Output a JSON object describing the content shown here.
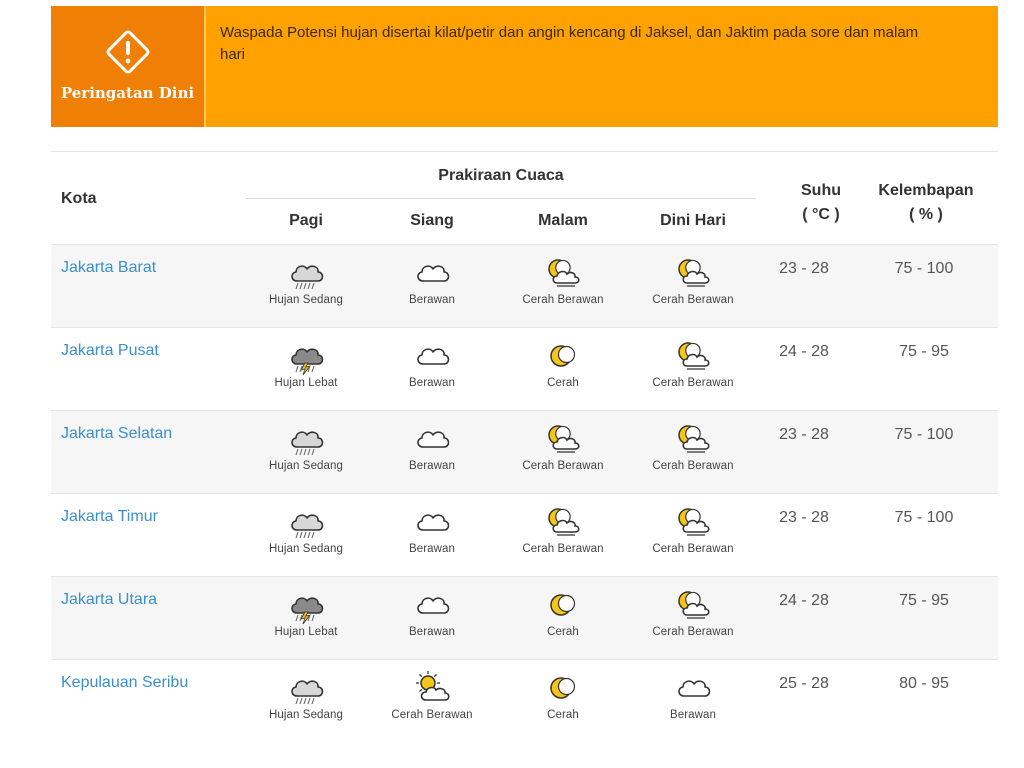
{
  "warning": {
    "badge_label": "Peringatan Dini",
    "text": "Waspada Potensi hujan disertai kilat/petir dan angin kencang di Jaksel, dan Jaktim pada sore dan malam hari",
    "colors": {
      "banner": "#FFA100",
      "badge": "#F07F06"
    }
  },
  "table": {
    "headers": {
      "city": "Kota",
      "forecast": "Prakiraan Cuaca",
      "periods": [
        "Pagi",
        "Siang",
        "Malam",
        "Dini Hari"
      ],
      "temp": "Suhu",
      "temp_unit": "( °C )",
      "humidity": "Kelembapan",
      "humidity_unit": "( % )"
    },
    "rows": [
      {
        "city": "Jakarta Barat",
        "forecast": [
          {
            "icon": "rain-cloud-icon",
            "label": "Hujan Sedang"
          },
          {
            "icon": "cloud-icon",
            "label": "Berawan"
          },
          {
            "icon": "moon-cloud-icon",
            "label": "Cerah Berawan"
          },
          {
            "icon": "moon-cloud-icon",
            "label": "Cerah Berawan"
          }
        ],
        "temp": "23 - 28",
        "humidity": "75 - 100"
      },
      {
        "city": "Jakarta Pusat",
        "forecast": [
          {
            "icon": "storm-cloud-icon",
            "label": "Hujan Lebat"
          },
          {
            "icon": "cloud-icon",
            "label": "Berawan"
          },
          {
            "icon": "moon-icon",
            "label": "Cerah"
          },
          {
            "icon": "moon-cloud-icon",
            "label": "Cerah Berawan"
          }
        ],
        "temp": "24 - 28",
        "humidity": "75 - 95"
      },
      {
        "city": "Jakarta Selatan",
        "forecast": [
          {
            "icon": "rain-cloud-icon",
            "label": "Hujan Sedang"
          },
          {
            "icon": "cloud-icon",
            "label": "Berawan"
          },
          {
            "icon": "moon-cloud-icon",
            "label": "Cerah Berawan"
          },
          {
            "icon": "moon-cloud-icon",
            "label": "Cerah Berawan"
          }
        ],
        "temp": "23 - 28",
        "humidity": "75 - 100"
      },
      {
        "city": "Jakarta Timur",
        "forecast": [
          {
            "icon": "rain-cloud-icon",
            "label": "Hujan Sedang"
          },
          {
            "icon": "cloud-icon",
            "label": "Berawan"
          },
          {
            "icon": "moon-cloud-icon",
            "label": "Cerah Berawan"
          },
          {
            "icon": "moon-cloud-icon",
            "label": "Cerah Berawan"
          }
        ],
        "temp": "23 - 28",
        "humidity": "75 - 100"
      },
      {
        "city": "Jakarta Utara",
        "forecast": [
          {
            "icon": "storm-cloud-icon",
            "label": "Hujan Lebat"
          },
          {
            "icon": "cloud-icon",
            "label": "Berawan"
          },
          {
            "icon": "moon-icon",
            "label": "Cerah"
          },
          {
            "icon": "moon-cloud-icon",
            "label": "Cerah Berawan"
          }
        ],
        "temp": "24 - 28",
        "humidity": "75 - 95"
      },
      {
        "city": "Kepulauan Seribu",
        "forecast": [
          {
            "icon": "rain-cloud-icon",
            "label": "Hujan Sedang"
          },
          {
            "icon": "sun-cloud-icon",
            "label": "Cerah Berawan"
          },
          {
            "icon": "moon-icon",
            "label": "Cerah"
          },
          {
            "icon": "cloud-icon",
            "label": "Berawan"
          }
        ],
        "temp": "25 - 28",
        "humidity": "80 - 95"
      }
    ]
  }
}
